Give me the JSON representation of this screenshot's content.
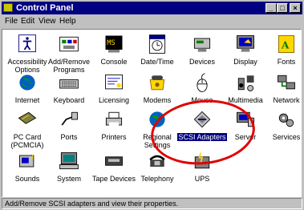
{
  "window": {
    "title": "Control Panel"
  },
  "menu": {
    "file": "File",
    "edit": "Edit",
    "view": "View",
    "help": "Help"
  },
  "items": [
    {
      "label": "Accessibility Options",
      "line1": "Accessibility",
      "line2": "Options",
      "icon": "accessibility-icon"
    },
    {
      "label": "Add/Remove Programs",
      "line1": "Add/Remove",
      "line2": "Programs",
      "icon": "add-remove-programs-icon"
    },
    {
      "label": "Console",
      "line1": "Console",
      "line2": "",
      "icon": "console-icon"
    },
    {
      "label": "Date/Time",
      "line1": "Date/Time",
      "line2": "",
      "icon": "date-time-icon"
    },
    {
      "label": "Devices",
      "line1": "Devices",
      "line2": "",
      "icon": "devices-icon"
    },
    {
      "label": "Display",
      "line1": "Display",
      "line2": "",
      "icon": "display-icon"
    },
    {
      "label": "Fonts",
      "line1": "Fonts",
      "line2": "",
      "icon": "fonts-icon"
    },
    {
      "label": "Internet",
      "line1": "Internet",
      "line2": "",
      "icon": "internet-icon"
    },
    {
      "label": "Keyboard",
      "line1": "Keyboard",
      "line2": "",
      "icon": "keyboard-icon"
    },
    {
      "label": "Licensing",
      "line1": "Licensing",
      "line2": "",
      "icon": "licensing-icon"
    },
    {
      "label": "Modems",
      "line1": "Modems",
      "line2": "",
      "icon": "modem-icon"
    },
    {
      "label": "Mouse",
      "line1": "Mouse",
      "line2": "",
      "icon": "mouse-icon"
    },
    {
      "label": "Multimedia",
      "line1": "Multimedia",
      "line2": "",
      "icon": "multimedia-icon"
    },
    {
      "label": "Network",
      "line1": "Network",
      "line2": "",
      "icon": "network-icon"
    },
    {
      "label": "PC Card (PCMCIA)",
      "line1": "PC Card",
      "line2": "(PCMCIA)",
      "icon": "pc-card-icon"
    },
    {
      "label": "Ports",
      "line1": "Ports",
      "line2": "",
      "icon": "ports-icon"
    },
    {
      "label": "Printers",
      "line1": "Printers",
      "line2": "",
      "icon": "printers-icon"
    },
    {
      "label": "Regional Settings",
      "line1": "Regional",
      "line2": "Settings",
      "icon": "regional-settings-icon"
    },
    {
      "label": "SCSI Adapters",
      "line1": "SCSI Adapters",
      "line2": "",
      "icon": "scsi-adapters-icon",
      "selected": true
    },
    {
      "label": "Server",
      "line1": "Server",
      "line2": "",
      "icon": "server-icon"
    },
    {
      "label": "Services",
      "line1": "Services",
      "line2": "",
      "icon": "services-icon"
    },
    {
      "label": "Sounds",
      "line1": "Sounds",
      "line2": "",
      "icon": "sounds-icon"
    },
    {
      "label": "System",
      "line1": "System",
      "line2": "",
      "icon": "system-icon"
    },
    {
      "label": "Tape Devices",
      "line1": "Tape Devices",
      "line2": "",
      "icon": "tape-devices-icon"
    },
    {
      "label": "Telephony",
      "line1": "Telephony",
      "line2": "",
      "icon": "telephony-icon"
    },
    {
      "label": "UPS",
      "line1": "UPS",
      "line2": "",
      "icon": "ups-icon"
    }
  ],
  "status": {
    "text": "Add/Remove SCSI adapters and view their properties."
  },
  "colors": {
    "title_bg": "#000080",
    "selection": "#000080",
    "annotation": "#e00000",
    "face": "#c0c0c0"
  }
}
